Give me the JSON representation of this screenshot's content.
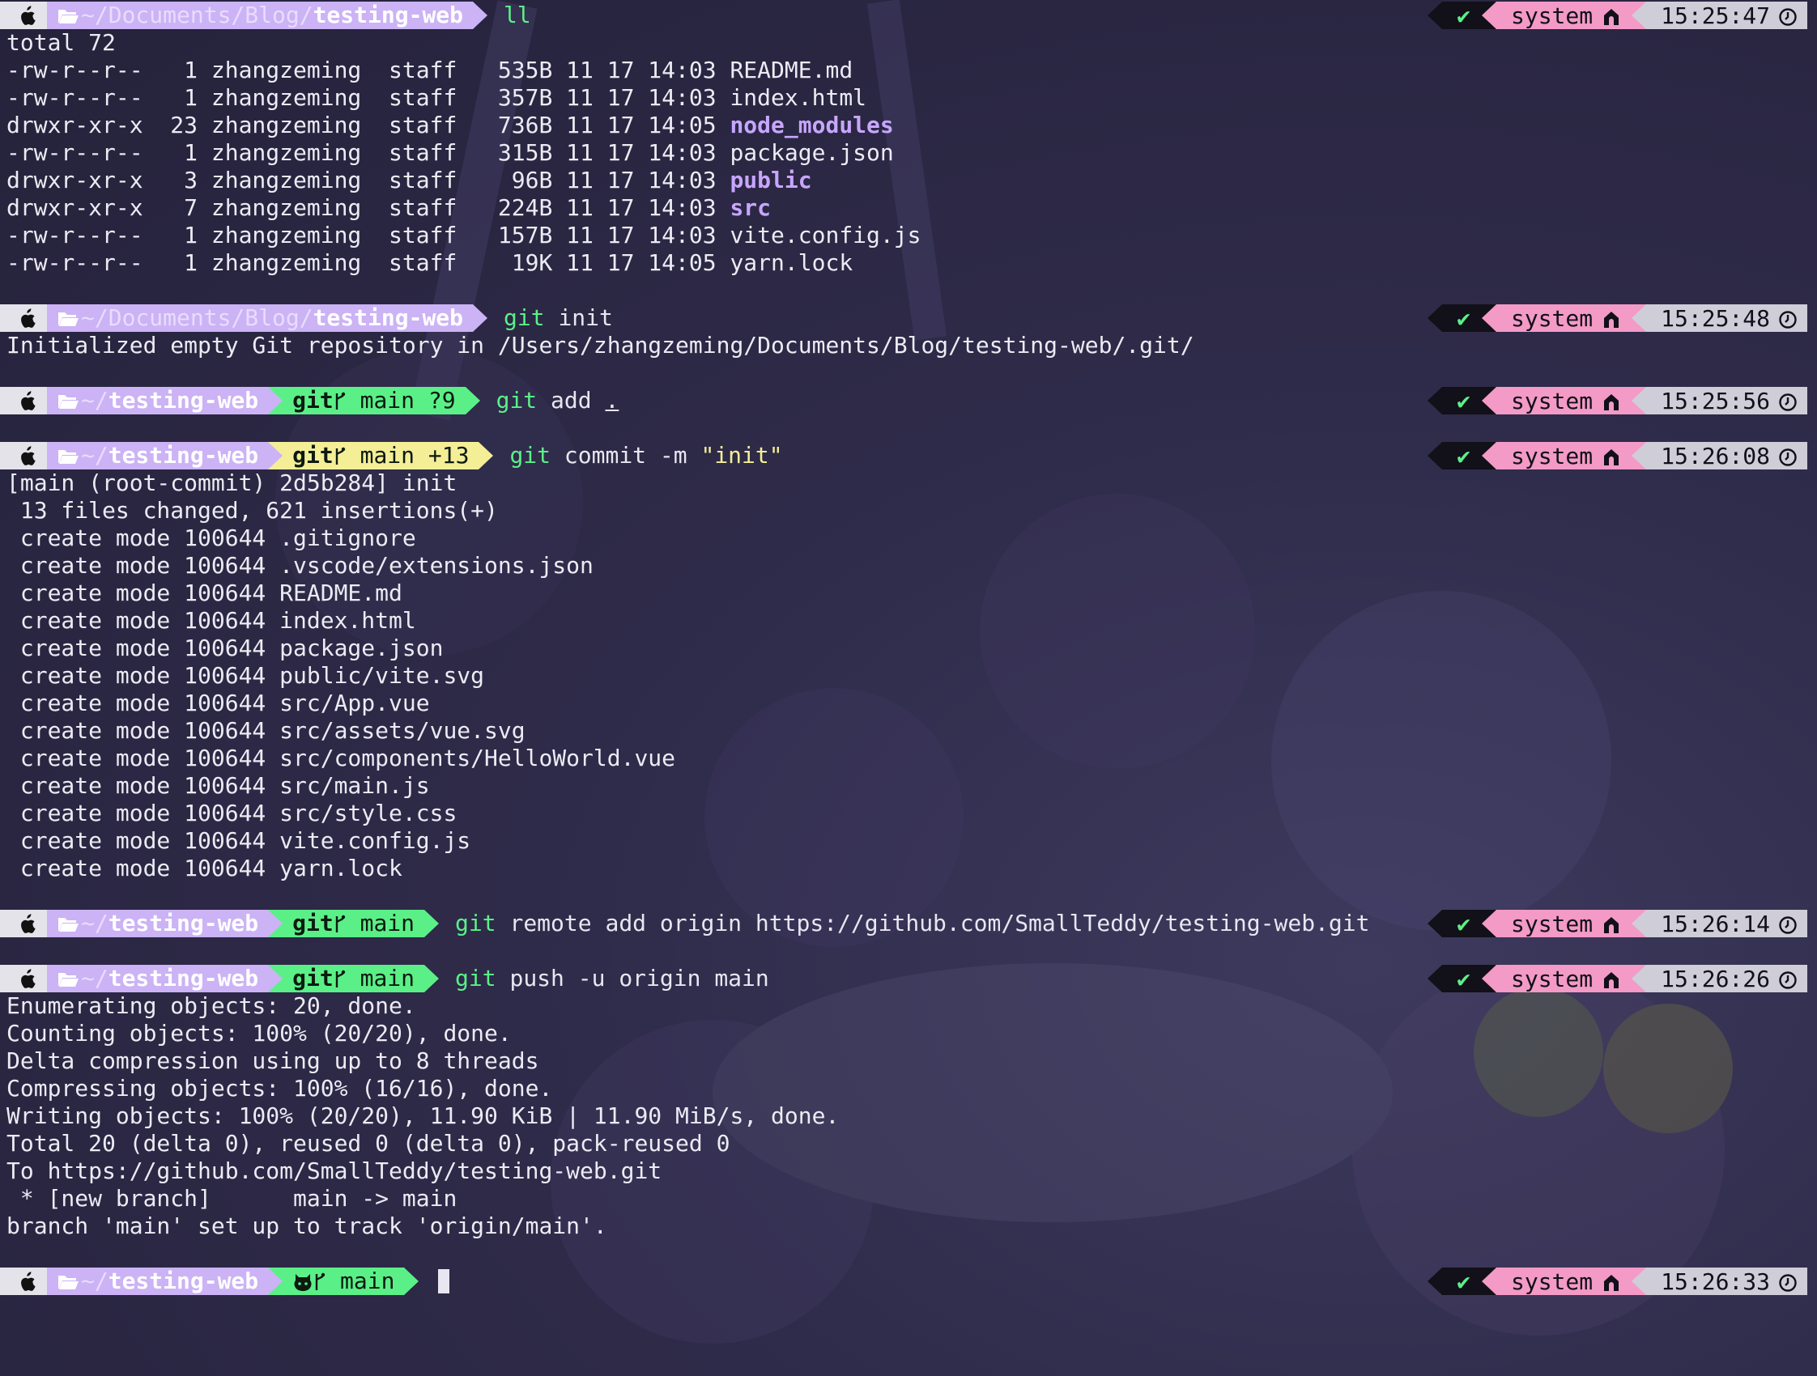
{
  "colors": {
    "apple_segment": "#e4e3ea",
    "dir_segment": "#cbb3f5",
    "git_segment": "#5bf087",
    "ok_segment": "#121018",
    "env_segment": "#f39ac6",
    "time_segment": "#cfcdd8",
    "command_green": "#5bf087",
    "string_yellow": "#f4ee97",
    "directory_purple": "#c7a6ff"
  },
  "status": {
    "ok_mark": "✔",
    "env_label": "system"
  },
  "blocks": [
    {
      "prompt": {
        "path_dim": "~/Documents/Blog/",
        "path_bold": "testing-web",
        "git": null,
        "command_head": "ll",
        "command_rest": ""
      },
      "time": "15:25:47",
      "output": [
        {
          "text": "total 72"
        },
        {
          "text": "-rw-r--r--   1 zhangzeming  staff   535B 11 17 14:03 ",
          "name": "README.md",
          "is_dir": false
        },
        {
          "text": "-rw-r--r--   1 zhangzeming  staff   357B 11 17 14:03 ",
          "name": "index.html",
          "is_dir": false
        },
        {
          "text": "drwxr-xr-x  23 zhangzeming  staff   736B 11 17 14:05 ",
          "name": "node_modules",
          "is_dir": true
        },
        {
          "text": "-rw-r--r--   1 zhangzeming  staff   315B 11 17 14:03 ",
          "name": "package.json",
          "is_dir": false
        },
        {
          "text": "drwxr-xr-x   3 zhangzeming  staff    96B 11 17 14:03 ",
          "name": "public",
          "is_dir": true
        },
        {
          "text": "drwxr-xr-x   7 zhangzeming  staff   224B 11 17 14:03 ",
          "name": "src",
          "is_dir": true
        },
        {
          "text": "-rw-r--r--   1 zhangzeming  staff   157B 11 17 14:03 ",
          "name": "vite.config.js",
          "is_dir": false
        },
        {
          "text": "-rw-r--r--   1 zhangzeming  staff    19K 11 17 14:05 ",
          "name": "yarn.lock",
          "is_dir": false
        }
      ]
    },
    {
      "prompt": {
        "path_dim": "~/Documents/Blog/",
        "path_bold": "testing-web",
        "git": null,
        "command_head": "git",
        "command_rest": " init"
      },
      "time": "15:25:48",
      "output": [
        {
          "text": "Initialized empty Git repository in /Users/zhangzeming/Documents/Blog/testing-web/.git/"
        }
      ]
    },
    {
      "prompt": {
        "path_dim": "~/",
        "path_bold": "testing-web",
        "git": "main ?9",
        "git_label": "git",
        "command_head": "git",
        "command_rest": " add ."
      },
      "time": "15:25:56",
      "output": []
    },
    {
      "prompt": {
        "path_dim": "~/",
        "path_bold": "testing-web",
        "git": "main +13",
        "git_label": "git",
        "git_yellow": true,
        "command_head": "git",
        "command_rest": " commit -m ",
        "command_str": "\"init\""
      },
      "time": "15:26:08",
      "output": [
        {
          "text": "[main (root-commit) 2d5b284] init"
        },
        {
          "text": " 13 files changed, 621 insertions(+)"
        },
        {
          "text": " create mode 100644 .gitignore"
        },
        {
          "text": " create mode 100644 .vscode/extensions.json"
        },
        {
          "text": " create mode 100644 README.md"
        },
        {
          "text": " create mode 100644 index.html"
        },
        {
          "text": " create mode 100644 package.json"
        },
        {
          "text": " create mode 100644 public/vite.svg"
        },
        {
          "text": " create mode 100644 src/App.vue"
        },
        {
          "text": " create mode 100644 src/assets/vue.svg"
        },
        {
          "text": " create mode 100644 src/components/HelloWorld.vue"
        },
        {
          "text": " create mode 100644 src/main.js"
        },
        {
          "text": " create mode 100644 src/style.css"
        },
        {
          "text": " create mode 100644 vite.config.js"
        },
        {
          "text": " create mode 100644 yarn.lock"
        }
      ]
    },
    {
      "prompt": {
        "path_dim": "~/",
        "path_bold": "testing-web",
        "git": "main",
        "git_label": "git",
        "command_head": "git",
        "command_rest": " remote add origin https://github.com/SmallTeddy/testing-web.git"
      },
      "time": "15:26:14",
      "output": []
    },
    {
      "prompt": {
        "path_dim": "~/",
        "path_bold": "testing-web",
        "git": "main",
        "git_label": "git",
        "command_head": "git",
        "command_rest": " push -u origin main"
      },
      "time": "15:26:26",
      "output": [
        {
          "text": "Enumerating objects: 20, done."
        },
        {
          "text": "Counting objects: 100% (20/20), done."
        },
        {
          "text": "Delta compression using up to 8 threads"
        },
        {
          "text": "Compressing objects: 100% (16/16), done."
        },
        {
          "text": "Writing objects: 100% (20/20), 11.90 KiB | 11.90 MiB/s, done."
        },
        {
          "text": "Total 20 (delta 0), reused 0 (delta 0), pack-reused 0"
        },
        {
          "text": "To https://github.com/SmallTeddy/testing-web.git"
        },
        {
          "text": " * [new branch]      main -> main"
        },
        {
          "text": "branch 'main' set up to track 'origin/main'."
        }
      ]
    },
    {
      "prompt": {
        "path_dim": "~/",
        "path_bold": "testing-web",
        "git": "main",
        "git_label": "github-icon",
        "command_head": "",
        "command_rest": "",
        "cursor": true
      },
      "time": "15:26:33",
      "output": []
    }
  ]
}
